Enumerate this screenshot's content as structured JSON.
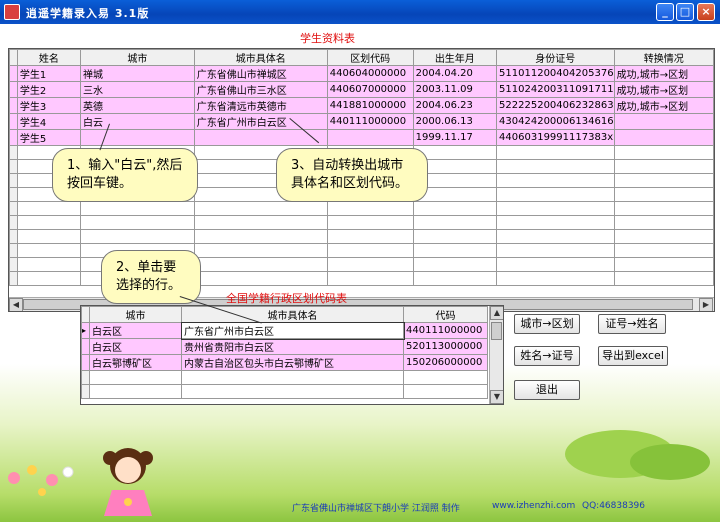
{
  "window": {
    "title": "逍遥学籍录入易    3.1版",
    "min_label": "_",
    "max_label": "□",
    "close_label": "×"
  },
  "student_grid": {
    "title": "学生资料表",
    "columns": [
      "姓名",
      "城市",
      "城市具体名",
      "区划代码",
      "出生年月",
      "身份证号",
      "转换情况"
    ],
    "rows": [
      [
        "学生1",
        "禅城",
        "广东省佛山市禅城区",
        "440604000000",
        "2004.04.20",
        "511011200404205376",
        "成功,城市→区划"
      ],
      [
        "学生2",
        "三水",
        "广东省佛山市三水区",
        "440607000000",
        "2003.11.09",
        "511024200311091711",
        "成功,城市→区划"
      ],
      [
        "学生3",
        "英德",
        "广东省清远市英德市",
        "441881000000",
        "2004.06.23",
        "522225200406232863",
        "成功,城市→区划"
      ],
      [
        "学生4",
        "白云",
        "广东省广州市白云区",
        "440111000000",
        "2000.06.13",
        "430424200006134616",
        ""
      ],
      [
        "学生5",
        "",
        "",
        "",
        "1999.11.17",
        "44060319991117383x",
        ""
      ]
    ]
  },
  "region_grid": {
    "title": "全国学籍行政区划代码表",
    "columns": [
      "城市",
      "城市具体名",
      "代码"
    ],
    "rows": [
      [
        "白云区",
        "广东省广州市白云区",
        "440111000000"
      ],
      [
        "白云区",
        "贵州省贵阳市白云区",
        "520113000000"
      ],
      [
        "白云鄂博矿区",
        "内蒙古自治区包头市白云鄂博矿区",
        "150206000000"
      ]
    ]
  },
  "callouts": {
    "c1": "1、输入\"白云\",然后按回车键。",
    "c2": "2、单击要选择的行。",
    "c3": "3、自动转换出城市具体名和区划代码。"
  },
  "buttons": {
    "city_to_code": "城市→区划",
    "id_to_name": "证号→姓名",
    "name_to_id": "姓名→证号",
    "export_excel": "导出到excel",
    "exit": "退出"
  },
  "footer": {
    "author": "广东省佛山市禅城区下朗小学 江润照 制作",
    "website": "www.izhenzhi.com",
    "qq": "QQ:46838396"
  },
  "colors": {
    "title_bar": "#0645b8",
    "highlight_row": "#ffc8ff",
    "callout_bg": "#fffcc0",
    "grid_title": "#e01010"
  }
}
